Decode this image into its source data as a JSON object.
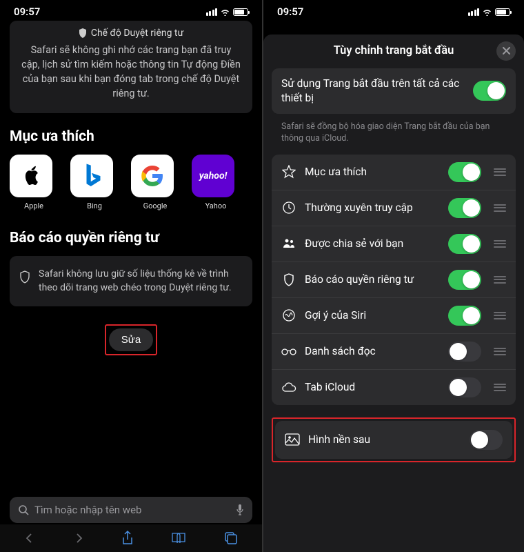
{
  "status": {
    "time": "09:57"
  },
  "left": {
    "private": {
      "title": "Chế độ Duyệt riêng tư",
      "desc": "Safari sẽ không ghi nhớ các trang bạn đã truy cập, lịch sử tìm kiếm hoặc thông tin Tự động Điền của bạn sau khi bạn đóng tab trong chế độ Duyệt riêng tư."
    },
    "favorites": {
      "title": "Mục ưa thích",
      "items": [
        {
          "label": "Apple"
        },
        {
          "label": "Bing"
        },
        {
          "label": "Google"
        },
        {
          "label": "Yahoo"
        }
      ]
    },
    "privacy_report": {
      "title": "Báo cáo quyền riêng tư",
      "text": "Safari không lưu giữ số liệu thống kê về trình theo dõi trang web chéo trong Duyệt riêng tư."
    },
    "edit": "Sửa",
    "search_placeholder": "Tìm hoặc nhập tên web"
  },
  "right": {
    "modal_title": "Tùy chỉnh trang bắt đầu",
    "sync_label": "Sử dụng Trang bắt đầu trên tất cả các thiết bị",
    "hint": "Safari sẽ đồng bộ hóa giao diện Trang bắt đầu của bạn thông qua iCloud.",
    "rows": [
      {
        "label": "Mục ưa thích",
        "on": true
      },
      {
        "label": "Thường xuyên truy cập",
        "on": true
      },
      {
        "label": "Được chia sẻ với bạn",
        "on": true
      },
      {
        "label": "Báo cáo quyền riêng tư",
        "on": true
      },
      {
        "label": "Gợi ý của Siri",
        "on": true
      },
      {
        "label": "Danh sách đọc",
        "on": false
      },
      {
        "label": "Tab iCloud",
        "on": false
      }
    ],
    "background": {
      "label": "Hình nền sau",
      "on": false
    }
  }
}
